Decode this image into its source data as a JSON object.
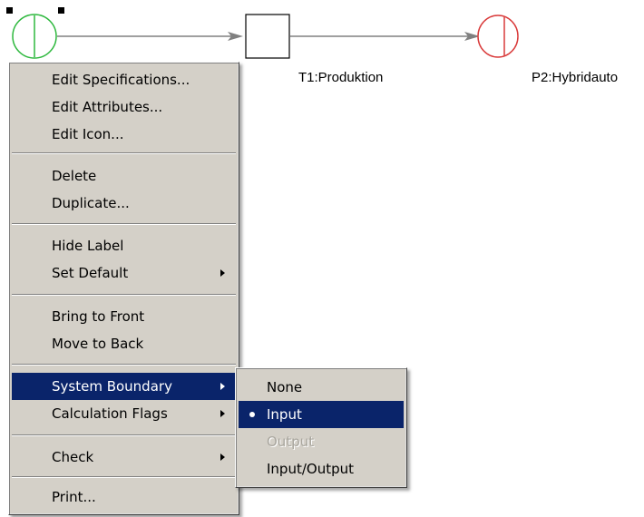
{
  "diagram": {
    "transition_label": "T1:Produktion",
    "place2_label": "P2:Hybridauto"
  },
  "context_menu": {
    "items": [
      {
        "label": "Edit Specifications...",
        "state": "normal",
        "submenu": false
      },
      {
        "label": "Edit Attributes...",
        "state": "normal",
        "submenu": false
      },
      {
        "label": "Edit Icon...",
        "state": "normal",
        "submenu": false
      },
      {
        "label": "Delete",
        "state": "normal",
        "submenu": false
      },
      {
        "label": "Duplicate...",
        "state": "normal",
        "submenu": false
      },
      {
        "label": "Hide Label",
        "state": "normal",
        "submenu": false
      },
      {
        "label": "Set Default",
        "state": "normal",
        "submenu": true
      },
      {
        "label": "Bring to Front",
        "state": "normal",
        "submenu": false
      },
      {
        "label": "Move to Back",
        "state": "normal",
        "submenu": false
      },
      {
        "label": "System Boundary",
        "state": "selected",
        "submenu": true
      },
      {
        "label": "Calculation Flags",
        "state": "normal",
        "submenu": true
      },
      {
        "label": "Check",
        "state": "normal",
        "submenu": true
      },
      {
        "label": "Print...",
        "state": "normal",
        "submenu": false
      }
    ]
  },
  "submenu_system_boundary": {
    "items": [
      {
        "label": "None",
        "state": "normal",
        "checked": false
      },
      {
        "label": "Input",
        "state": "selected",
        "checked": true
      },
      {
        "label": "Output",
        "state": "disabled",
        "checked": false
      },
      {
        "label": "Input/Output",
        "state": "normal",
        "checked": false
      }
    ]
  },
  "colors": {
    "place1_stroke": "#2db83d",
    "place2_stroke": "#d93a3a",
    "arc": "#808080",
    "menu_bg": "#d4d0c8",
    "highlight": "#0a246a"
  }
}
